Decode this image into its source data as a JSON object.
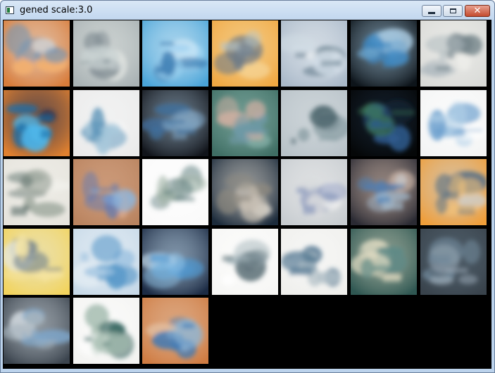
{
  "window": {
    "title": "gened scale:3.0",
    "icon": "app-window-icon",
    "controls": [
      {
        "name": "minimize-button",
        "icon": "minimize-icon"
      },
      {
        "name": "maximize-button",
        "icon": "maximize-icon"
      },
      {
        "name": "close-button",
        "icon": "close-icon",
        "glyph": "✕"
      }
    ]
  },
  "grid": {
    "columns": 7,
    "rows": 5,
    "count": 31,
    "tiles": [
      {
        "bg": "#d87c3a",
        "fg": "#6f93b6",
        "acc": "#f2b070",
        "hi": "#e7e2dc"
      },
      {
        "bg": "#a9b2b4",
        "fg": "#7f8c92",
        "acc": "#c8d1d2",
        "hi": "#e2e6e3"
      },
      {
        "bg": "#4aa4d8",
        "fg": "#2e6fa8",
        "acc": "#9bd1f0",
        "hi": "#e9f5fb"
      },
      {
        "bg": "#f0a843",
        "fg": "#6d7b87",
        "acc": "#b8c7cc",
        "hi": "#f6dca4"
      },
      {
        "bg": "#aab9c9",
        "fg": "#6f8796",
        "acc": "#d2dde6",
        "hi": "#eef2f5"
      },
      {
        "bg": "#0d141a",
        "fg": "#3d88c2",
        "acc": "#6fa7cf",
        "hi": "#a6c7dd"
      },
      {
        "bg": "#d9dad7",
        "fg": "#6b7c83",
        "acc": "#aeb9be",
        "hi": "#f2f2ef"
      },
      {
        "bg": "#e0802f",
        "fg": "#1b6fa9",
        "acc": "#4fb6e9",
        "hi": "#1a2c55"
      },
      {
        "bg": "#eaeaea",
        "fg": "#5a93b8",
        "acc": "#a9c9dc",
        "hi": "#f6f7f7"
      },
      {
        "bg": "#11141a",
        "fg": "#3f6f9c",
        "acc": "#7aa0bf",
        "hi": "#9fb8cc"
      },
      {
        "bg": "#3f6e64",
        "fg": "#6f9aa8",
        "acc": "#d7b1a3",
        "hi": "#8fb9b0"
      },
      {
        "bg": "#b8c2c8",
        "fg": "#506870",
        "acc": "#8ca0a6",
        "hi": "#d9dfe2"
      },
      {
        "bg": "#050708",
        "fg": "#2d5b8e",
        "acc": "#3e7a58",
        "hi": "#1b2b3e"
      },
      {
        "bg": "#f3f4f4",
        "fg": "#6fa2cf",
        "acc": "#b7d4ea",
        "hi": "#ffffff"
      },
      {
        "bg": "#e6e4dd",
        "fg": "#566a66",
        "acc": "#a3aca2",
        "hi": "#f2f1ec"
      },
      {
        "bg": "#b9835f",
        "fg": "#5d79b6",
        "acc": "#8fb3d8",
        "hi": "#d8a98a"
      },
      {
        "bg": "#fafafa",
        "fg": "#5b7b7c",
        "acc": "#a3b5a9",
        "hi": "#ffffff"
      },
      {
        "bg": "#1c2b3b",
        "fg": "#c8c0b4",
        "acc": "#8f8a80",
        "hi": "#e7e1d7"
      },
      {
        "bg": "#c7ccd0",
        "fg": "#7f8fb7",
        "acc": "#d8dadc",
        "hi": "#eeeeee"
      },
      {
        "bg": "#2a2a33",
        "fg": "#4d7eb4",
        "acc": "#a8c1d6",
        "hi": "#e2c7b5"
      },
      {
        "bg": "#ef9e3a",
        "fg": "#5b7284",
        "acc": "#f3c37b",
        "hi": "#cbd4da"
      },
      {
        "bg": "#f2d45e",
        "fg": "#6a7d8c",
        "acc": "#f6e6a4",
        "hi": "#e7e7d8"
      },
      {
        "bg": "#c7d9e8",
        "fg": "#5a9ac9",
        "acc": "#9cc2e0",
        "hi": "#eef4f8"
      },
      {
        "bg": "#1c2b44",
        "fg": "#4f98d0",
        "acc": "#8ec1e6",
        "hi": "#c7e0f1"
      },
      {
        "bg": "#f6f6f4",
        "fg": "#5c6f77",
        "acc": "#9fb0b6",
        "hi": "#ffffff"
      },
      {
        "bg": "#efefec",
        "fg": "#456d8a",
        "acc": "#b3c1c8",
        "hi": "#fafafa"
      },
      {
        "bg": "#2f5752",
        "fg": "#e9e1c7",
        "acc": "#5f8a86",
        "hi": "#c8cbb7"
      },
      {
        "bg": "#39434c",
        "fg": "#6d8697",
        "acc": "#9aa9b5",
        "hi": "#5a6b78"
      },
      {
        "bg": "#3b444e",
        "fg": "#7ea6c9",
        "acc": "#a7b4be",
        "hi": "#d0d8de"
      },
      {
        "bg": "#f3f3f1",
        "fg": "#3e6b66",
        "acc": "#9fb8ab",
        "hi": "#ffffff"
      },
      {
        "bg": "#cf7c43",
        "fg": "#3b78b6",
        "acc": "#8fb6d6",
        "hi": "#e4c3a8"
      }
    ]
  }
}
